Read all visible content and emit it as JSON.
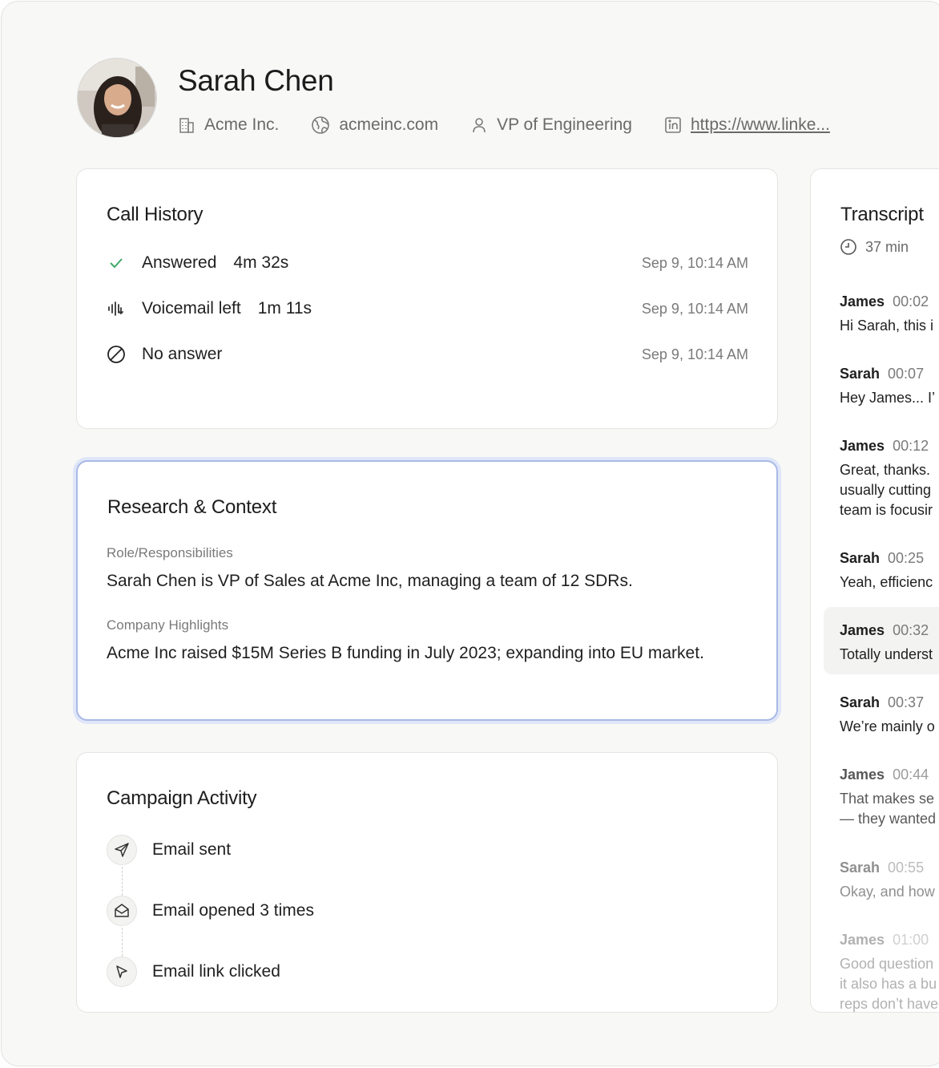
{
  "profile": {
    "name": "Sarah Chen",
    "company": "Acme Inc.",
    "website": "acmeinc.com",
    "role": "VP of Engineering",
    "linkedin": "https://www.linke..."
  },
  "call_history": {
    "title": "Call History",
    "items": [
      {
        "icon": "check-icon",
        "label": "Answered",
        "duration": "4m 32s",
        "date": "Sep 9, 10:14 AM"
      },
      {
        "icon": "voicemail-icon",
        "label": "Voicemail left",
        "duration": "1m 11s",
        "date": "Sep 9, 10:14 AM"
      },
      {
        "icon": "no-answer-icon",
        "label": "No answer",
        "duration": "",
        "date": "Sep 9, 10:14 AM"
      }
    ]
  },
  "research": {
    "title": "Research & Context",
    "role_label": "Role/Responsibilities",
    "role_text": "Sarah Chen is VP of Sales at Acme Inc, managing a team of 12 SDRs.",
    "highlights_label": "Company Highlights",
    "highlights_text": "Acme Inc raised $15M Series B funding in July 2023; expanding into EU market."
  },
  "campaign": {
    "title": "Campaign Activity",
    "items": [
      {
        "icon": "send-icon",
        "label": "Email sent"
      },
      {
        "icon": "mail-open-icon",
        "label": "Email opened 3 times"
      },
      {
        "icon": "cursor-icon",
        "label": "Email link clicked"
      }
    ]
  },
  "transcript": {
    "title": "Transcript",
    "duration": "37 min",
    "entries": [
      {
        "speaker": "James",
        "time": "00:02",
        "lines": [
          "Hi Sarah, this i"
        ]
      },
      {
        "speaker": "Sarah",
        "time": "00:07",
        "lines": [
          "Hey James... I’"
        ]
      },
      {
        "speaker": "James",
        "time": "00:12",
        "lines": [
          "Great, thanks.",
          "usually cutting",
          "team is focusir"
        ]
      },
      {
        "speaker": "Sarah",
        "time": "00:25",
        "lines": [
          "Yeah, efficienc"
        ]
      },
      {
        "speaker": "James",
        "time": "00:32",
        "lines": [
          "Totally underst"
        ]
      },
      {
        "speaker": "Sarah",
        "time": "00:37",
        "lines": [
          "We’re mainly o"
        ]
      },
      {
        "speaker": "James",
        "time": "00:44",
        "lines": [
          "That makes se",
          "— they wanted"
        ]
      },
      {
        "speaker": "Sarah",
        "time": "00:55",
        "lines": [
          "Okay, and how"
        ]
      },
      {
        "speaker": "James",
        "time": "01:00",
        "lines": [
          "Good question",
          "it also has a bu",
          "reps don’t have"
        ]
      }
    ]
  },
  "colors": {
    "accent_border": "#a9b9e6",
    "check_green": "#3fa96a",
    "background": "#f8f8f7"
  }
}
